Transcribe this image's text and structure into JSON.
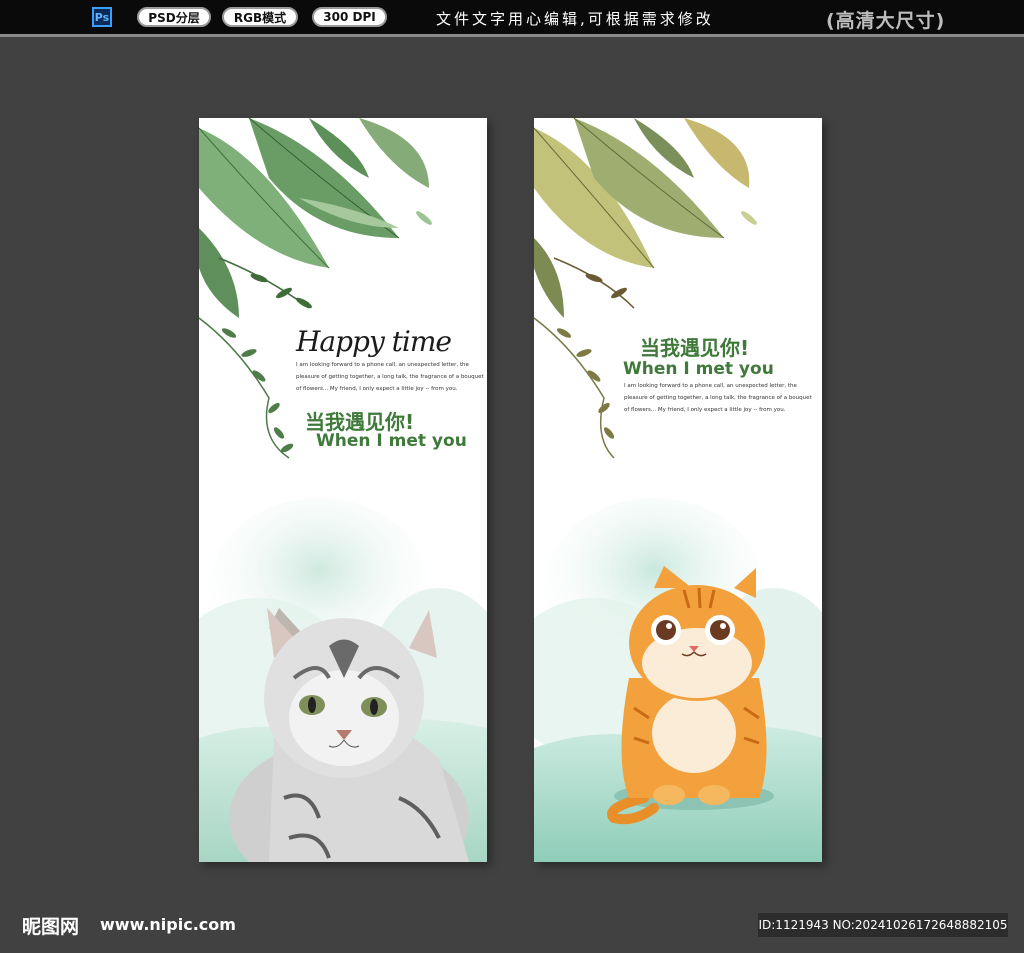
{
  "header": {
    "ps_icon_text": "Ps",
    "pills": [
      "PSD分层",
      "RGB模式",
      "300 DPI"
    ],
    "notice": "文件文字用心编辑,可根据需求修改",
    "size_badge": "(高清大尺寸)"
  },
  "left_panel": {
    "script_title": "Happy time",
    "paragraph": [
      "I am looking forward to a phone call, an unexpected letter, the",
      "pleasure of getting together, a long talk, the fragrance of a bouquet",
      "of flowers... My friend, I only expect a little joy -- from you."
    ],
    "cn_title": "当我遇见你!",
    "en_title": "When I met you"
  },
  "right_panel": {
    "cn_title": "当我遇见你!",
    "en_title": "When I met you",
    "paragraph": [
      "I am looking forward to a phone call, an unexpected letter, the",
      "pleasure of getting together, a long talk, the fragrance of a bouquet",
      "of flowers... My friend, I only expect a little joy -- from you."
    ]
  },
  "footer": {
    "logo": "昵图网",
    "url": "www.nipic.com",
    "id_text": "ID:1121943 NO:20241026172648882105"
  },
  "colors": {
    "background": "#414141",
    "leaf_green": "#6fa46a",
    "leaf_olive": "#b7b96a",
    "title_green": "#3f7a3a",
    "mint": "#a9d8c8"
  }
}
